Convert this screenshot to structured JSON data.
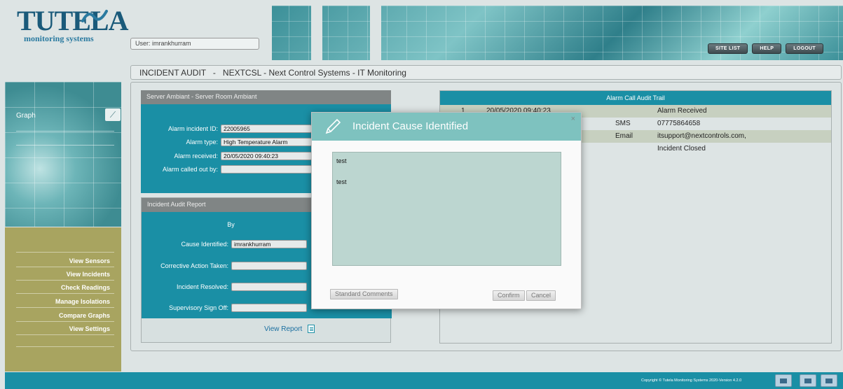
{
  "header": {
    "logo_text": "TUTELA",
    "logo_subtitle": "monitoring systems",
    "user_label": "User: imrankhurram",
    "buttons": [
      "SITE LIST",
      "HELP",
      "LOGOUT"
    ]
  },
  "breadcrumb": "INCIDENT AUDIT   -   NEXTCSL - Next Control Systems - IT Monitoring",
  "sidebar": {
    "graph_label": "Graph",
    "menu": [
      "View Sensors",
      "View Incidents",
      "Check Readings",
      "Manage Isolations",
      "Compare Graphs",
      "View Settings"
    ]
  },
  "server_panel": {
    "title": "Server Ambiant - Server Room Ambiant",
    "fields": [
      {
        "label": "Alarm incident ID:",
        "value": "22005965"
      },
      {
        "label": "Alarm type:",
        "value": "High Temperature Alarm"
      },
      {
        "label": "Alarm received:",
        "value": "20/05/2020 09:40:23"
      },
      {
        "label": "Alarm called out by:",
        "value": ""
      }
    ]
  },
  "audit_panel": {
    "title": "Incident Audit Report",
    "by_label": "By",
    "fields": [
      {
        "label": "Cause Identified:",
        "value": "imrankhurram"
      },
      {
        "label": "Corrective Action Taken:",
        "value": ""
      },
      {
        "label": "Incident Resolved:",
        "value": ""
      },
      {
        "label": "Supervisory Sign Off:",
        "value": ""
      }
    ],
    "view_report": "View Report"
  },
  "trail": {
    "title": "Alarm Call Audit Trail",
    "rows": [
      {
        "num": "1",
        "date": "20/05/2020 09:40:23",
        "method": "",
        "detail": "Alarm Received"
      },
      {
        "num": "",
        "date": "",
        "method": "SMS",
        "detail": "07775864658"
      },
      {
        "num": "",
        "date": "",
        "method": "Email",
        "detail": "itsupport@nextcontrols.com,"
      },
      {
        "num": "",
        "date": "",
        "method": "",
        "detail": "Incident Closed"
      }
    ]
  },
  "modal": {
    "title": "Incident Cause Identified",
    "close": "×",
    "comment_line1": "test",
    "comment_line2": "test",
    "standard_comments": "Standard Comments",
    "confirm": "Confirm",
    "cancel": "Cancel"
  },
  "footer": {
    "copyright": "Copyright © Tutela Monitoring Systems 2020-Version 4.2.0"
  }
}
